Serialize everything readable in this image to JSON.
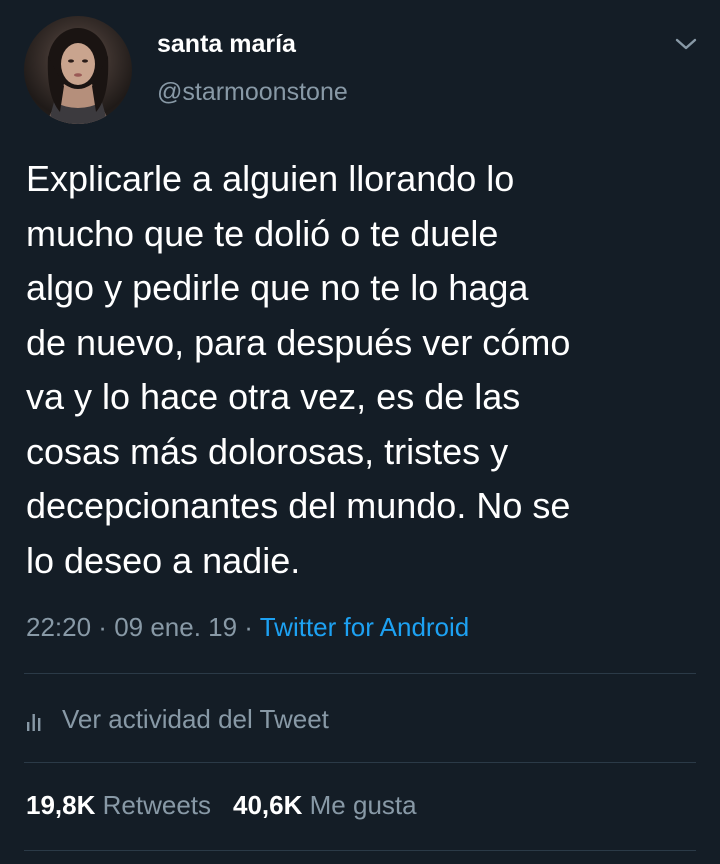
{
  "user": {
    "display_name": "santa maría",
    "handle": "@starmoonstone"
  },
  "tweet": {
    "text": "Explicarle a alguien llorando lo\nmucho que te dolió o te duele\nalgo y pedirle que no te lo haga\nde nuevo, para después ver cómo\nva y lo hace otra vez, es de las\ncosas más dolorosas, tristes y\ndecepcionantes del mundo. No se\nlo deseo a nadie.",
    "time": "22:20",
    "separator": " · ",
    "date": "09 ene. 19",
    "source": "Twitter for Android"
  },
  "activity": {
    "label": "Ver actividad del Tweet",
    "icon": "bar-chart-icon"
  },
  "stats": {
    "retweets_count": "19,8K",
    "retweets_label": "Retweets",
    "likes_count": "40,6K",
    "likes_label": "Me gusta"
  },
  "icons": {
    "menu": "chevron-down-icon",
    "avatar": "profile-photo"
  },
  "colors": {
    "background": "#141d26",
    "primary_text": "#ffffff",
    "secondary_text": "#8899a6",
    "link": "#1da1f2",
    "divider": "#2b3a47"
  }
}
